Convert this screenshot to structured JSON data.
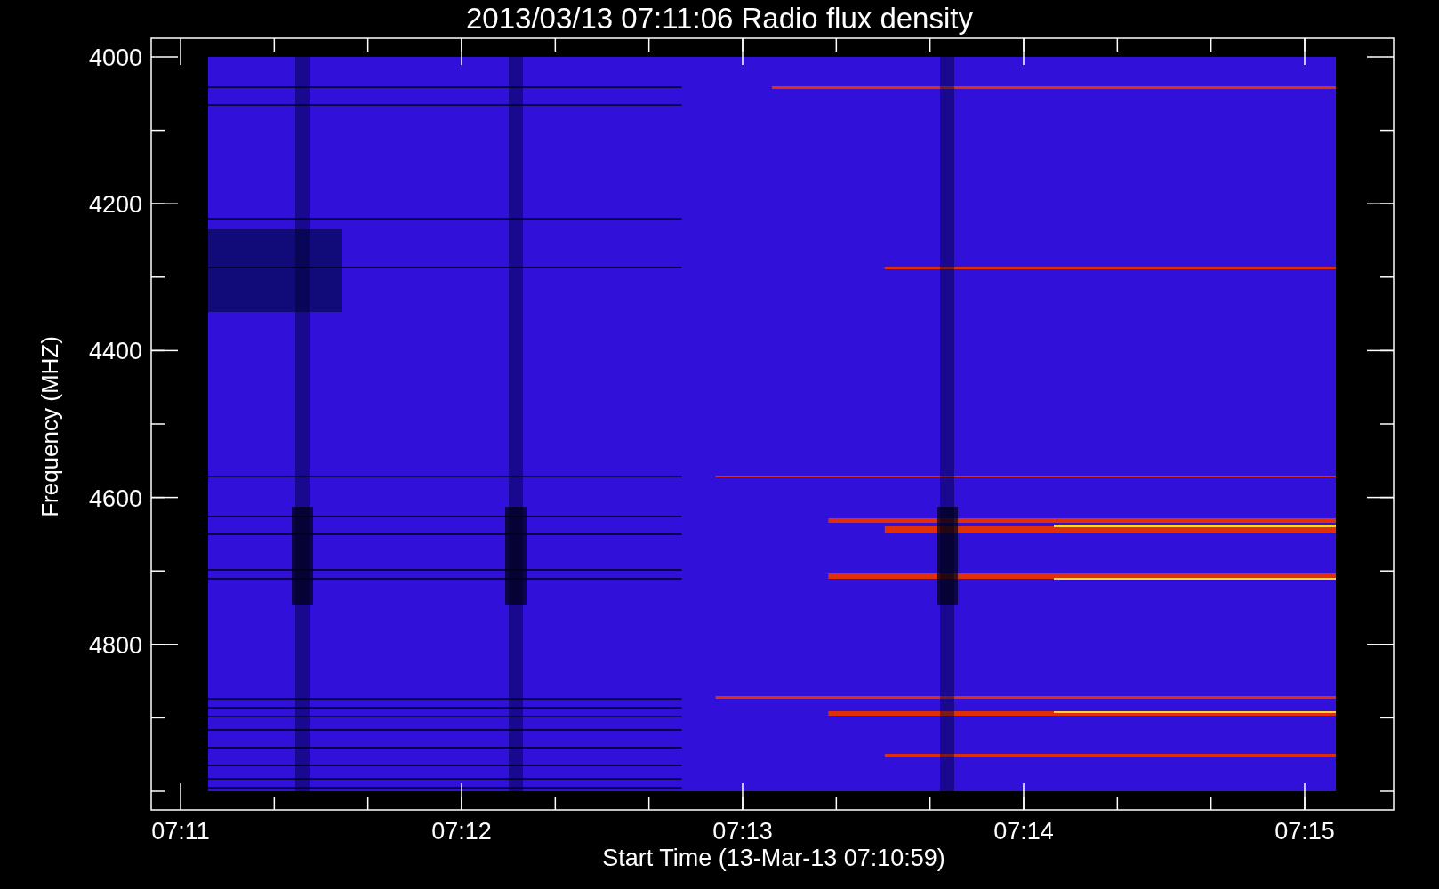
{
  "title": "2013/03/13 07:11:06 Radio flux density",
  "y_axis": {
    "label": "Frequency (MHZ)",
    "ticks": [
      "4000",
      "4200",
      "4400",
      "4600",
      "4800"
    ]
  },
  "x_axis": {
    "label": "Start Time (13-Mar-13 07:10:59)",
    "ticks": [
      "07:11",
      "07:12",
      "07:13",
      "07:14",
      "07:15"
    ]
  }
}
